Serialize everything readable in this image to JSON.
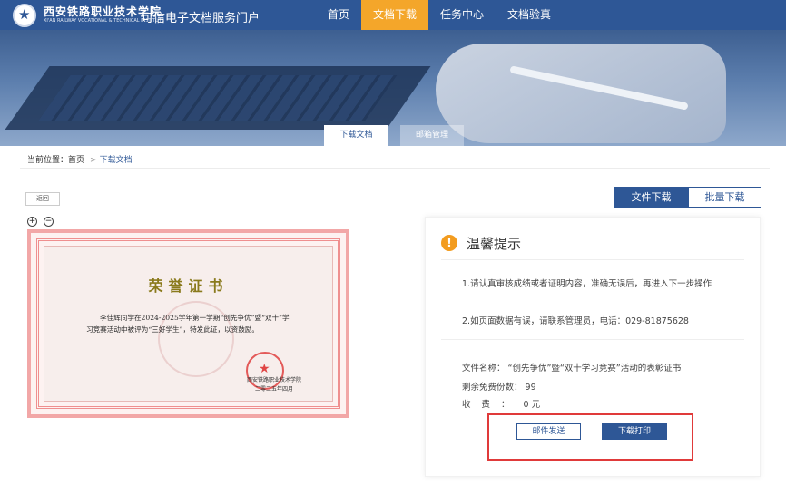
{
  "header": {
    "school_name_cn": "西安铁路职业技术学院",
    "school_name_en": "XI'AN RAILWAY VOCATIONAL & TECHNICAL INSTITUTE",
    "portal_title": "可信电子文档服务门户",
    "nav": [
      "首页",
      "文档下载",
      "任务中心",
      "文档验真"
    ],
    "active_nav": "文档下载"
  },
  "banner_tabs": [
    "下载文档",
    "邮箱管理"
  ],
  "breadcrumb": {
    "label": "当前位置",
    "home": "首页",
    "current": "下载文档"
  },
  "back_label": "返回",
  "zoom": {
    "in": "+",
    "out": "−"
  },
  "certificate": {
    "title": "荣誉证书",
    "body": "李佳辉同学在2024-2025学年第一学期“创先争优”暨“双十”学习竞赛活动中被评为“三好学生”，特发此证，以资鼓励。",
    "issuer": "西安铁路职业技术学院",
    "date": "二零二五年四月"
  },
  "action_tabs": [
    "文件下载",
    "批量下载"
  ],
  "tips": {
    "icon": "!",
    "title": "温馨提示",
    "item1": "1.请认真审核成绩或者证明内容，准确无误后，再进入下一步操作",
    "item2": "2.如页面数据有误，请联系管理员，电话：029-81875628"
  },
  "file_info": {
    "name_label": "文件名称：",
    "name": "“创先争优”暨“双十学习竞赛”活动的表彰证书",
    "remaining_label": "剩余免费份数：",
    "remaining": "99",
    "fee_label": "收费：",
    "fee": "0 元"
  },
  "buttons": {
    "mail": "邮件发送",
    "print": "下载打印"
  },
  "colors": {
    "primary": "#2e5796",
    "accent": "#f4a62a",
    "warn": "#f39c1f",
    "highlight": "#e03a3a"
  }
}
